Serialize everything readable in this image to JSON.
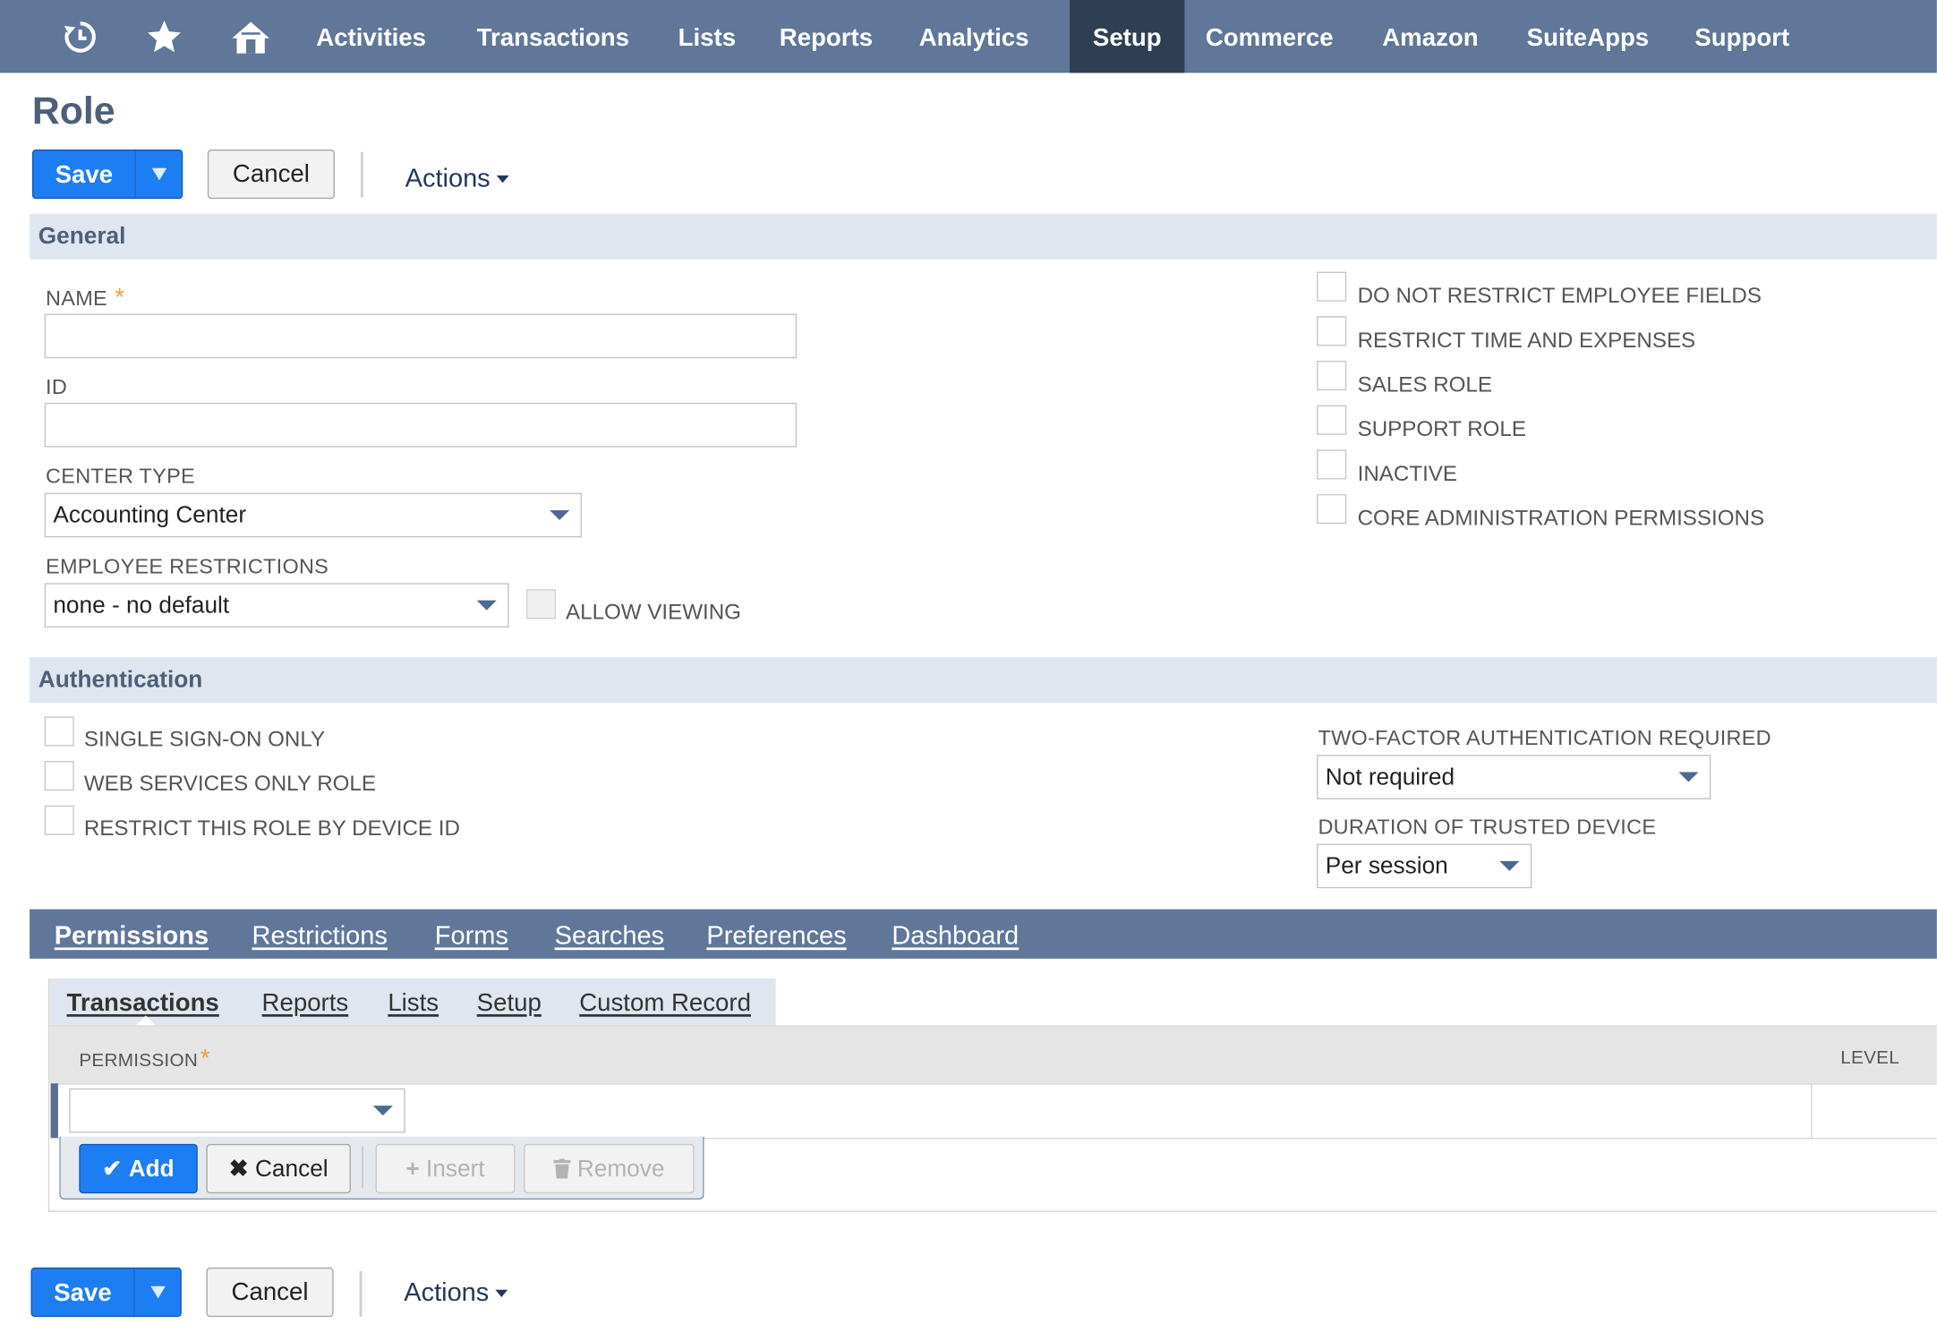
{
  "nav": {
    "icons": [
      "recent-icon",
      "favorite-star-icon",
      "home-icon"
    ],
    "items": [
      "Activities",
      "Transactions",
      "Lists",
      "Reports",
      "Analytics",
      "Setup",
      "Commerce",
      "Amazon",
      "SuiteApps",
      "Support"
    ],
    "active": "Setup"
  },
  "page_title": "Role",
  "toolbar": {
    "save_label": "Save",
    "cancel_label": "Cancel",
    "actions_label": "Actions"
  },
  "general": {
    "heading": "General",
    "name_label": "NAME",
    "name_value": "",
    "required_mark": "*",
    "id_label": "ID",
    "id_value": "",
    "center_type_label": "CENTER TYPE",
    "center_type_value": "Accounting Center",
    "employee_restrictions_label": "EMPLOYEE RESTRICTIONS",
    "employee_restrictions_value": "none - no default",
    "allow_viewing_label": "ALLOW VIEWING",
    "checkboxes": [
      {
        "label": "DO NOT RESTRICT EMPLOYEE FIELDS",
        "checked": false
      },
      {
        "label": "RESTRICT TIME AND EXPENSES",
        "checked": false
      },
      {
        "label": "SALES ROLE",
        "checked": false
      },
      {
        "label": "SUPPORT ROLE",
        "checked": false
      },
      {
        "label": "INACTIVE",
        "checked": false
      },
      {
        "label": "CORE ADMINISTRATION PERMISSIONS",
        "checked": false
      }
    ]
  },
  "authentication": {
    "heading": "Authentication",
    "checkboxes": [
      {
        "label": "SINGLE SIGN-ON ONLY",
        "checked": false
      },
      {
        "label": "WEB SERVICES ONLY ROLE",
        "checked": false
      },
      {
        "label": "RESTRICT THIS ROLE BY DEVICE ID",
        "checked": false
      }
    ],
    "two_factor_label": "TWO-FACTOR AUTHENTICATION REQUIRED",
    "two_factor_value": "Not required",
    "trusted_device_label": "DURATION OF TRUSTED DEVICE",
    "trusted_device_value": "Per session"
  },
  "tabs": {
    "items": [
      "Permissions",
      "Restrictions",
      "Forms",
      "Searches",
      "Preferences",
      "Dashboard"
    ],
    "active": "Permissions"
  },
  "subtabs": {
    "items": [
      "Transactions",
      "Reports",
      "Lists",
      "Setup",
      "Custom Record"
    ],
    "active": "Transactions"
  },
  "grid": {
    "permission_header": "PERMISSION",
    "level_header": "LEVEL",
    "permission_value": "",
    "buttons": {
      "add": "Add",
      "cancel": "Cancel",
      "insert": "Insert",
      "remove": "Remove"
    }
  },
  "colors": {
    "nav_bg": "#607799",
    "nav_active_bg": "#2f3f53",
    "primary_button": "#1d7ef4",
    "section_bg": "#e0e6ef",
    "required_star": "#e6a23c"
  }
}
